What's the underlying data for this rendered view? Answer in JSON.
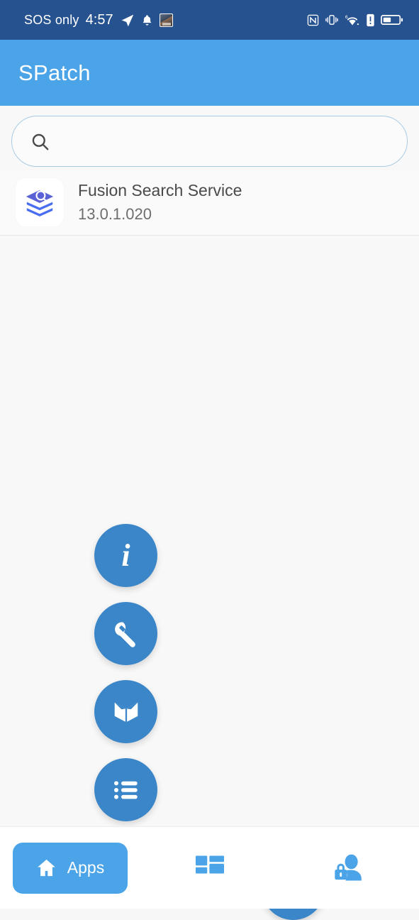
{
  "status_bar": {
    "carrier_text": "SOS only",
    "clock": "4:57",
    "left_icons": [
      "telegram-plane-icon",
      "bell-icon",
      "photo-notification-thumbnail"
    ],
    "right_icons": [
      "nfc-icon",
      "vibrate-icon",
      "wifi-6-icon",
      "alert-icon",
      "battery-icon"
    ],
    "network_generation_badge": "6",
    "background_color": "#26528f",
    "foreground_color": "#ffffff"
  },
  "app_bar": {
    "title": "SPatch",
    "background_color": "#4ba3e8",
    "title_color": "#ffffff"
  },
  "search": {
    "value": "",
    "placeholder": "",
    "icon": "search-icon",
    "border_color": "#a8cbe4"
  },
  "app_list": {
    "items": [
      {
        "icon": "fusion-search-layers-icon",
        "icon_color": "#5b62d6",
        "name": "Fusion Search Service",
        "version": "13.0.1.020"
      }
    ]
  },
  "fabs": {
    "accent_color": "#3a86c8",
    "column": [
      {
        "name": "info",
        "icon": "info-icon",
        "glyph": "i"
      },
      {
        "name": "tools",
        "icon": "wrench-icon"
      },
      {
        "name": "manual",
        "icon": "open-book-icon"
      },
      {
        "name": "list",
        "icon": "bullet-list-icon"
      }
    ],
    "add": {
      "name": "add",
      "icon": "plus-icon"
    }
  },
  "bottom_nav": {
    "active_color": "#4ba3e8",
    "icon_color": "#4ba3e8",
    "items": [
      {
        "label": "Apps",
        "icon": "home-icon",
        "active": true
      },
      {
        "label": "",
        "icon": "dashboard-grid-icon",
        "active": false
      },
      {
        "label": "",
        "icon": "user-lock-icon",
        "active": false
      }
    ]
  }
}
